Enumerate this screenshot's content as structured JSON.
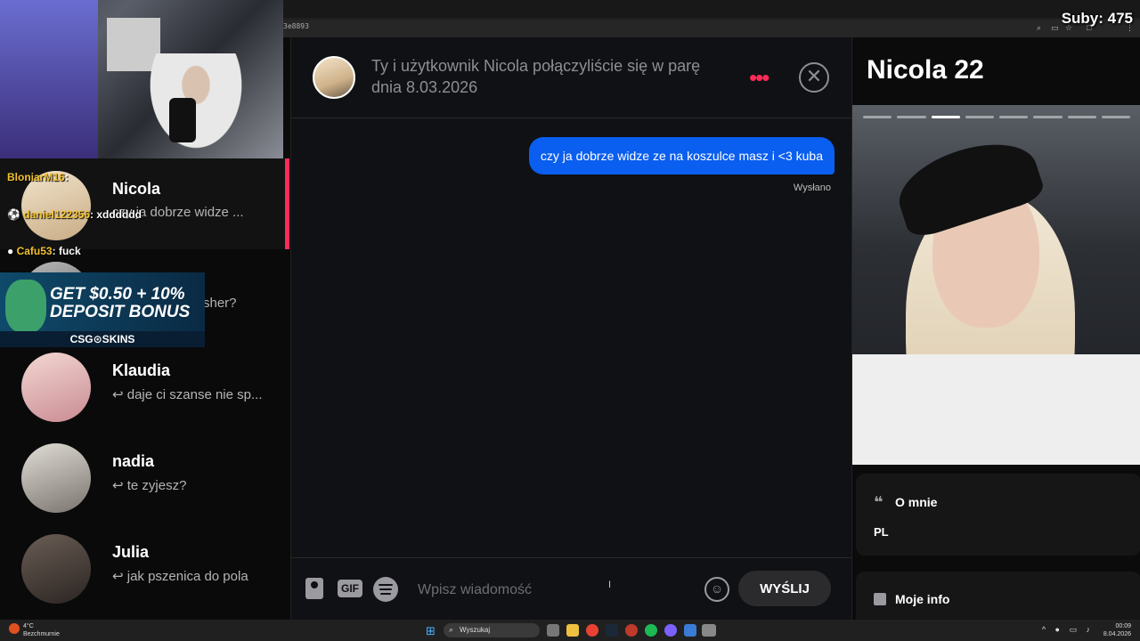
{
  "browser": {
    "url_fragment": "3e8893"
  },
  "stream": {
    "subs_label": "Suby: 475",
    "twitch_chat": [
      {
        "user": "BloniarM16",
        "message": ""
      },
      {
        "user": "daniel122356",
        "message": "xdddddd"
      },
      {
        "user": "Cafu53",
        "message": "fuck"
      }
    ],
    "ad": {
      "line1": "GET $0.50 + 10%",
      "line2": "DEPOSIT BONUS",
      "brand": "CSG⊙SKINS"
    }
  },
  "conversations": [
    {
      "name": "Nicola",
      "preview": "czy ja dobrze widze ...",
      "active": true
    },
    {
      "name": "",
      "preview": "sher?",
      "active": false
    },
    {
      "name": "Klaudia",
      "preview": "↩ daje ci szanse nie sp...",
      "active": false
    },
    {
      "name": "nadia",
      "preview": "↩ te zyjesz?",
      "active": false
    },
    {
      "name": "Julia",
      "preview": "↩ jak pszenica do pola",
      "active": false
    }
  ],
  "chat": {
    "match_text": "Ty i użytkownik Nicola połączyliście się w parę dnia 8.03.2026",
    "more_icon": "more-dots-icon",
    "close_icon": "close-circle-icon",
    "messages": [
      {
        "text": "czy ja dobrze widze ze na koszulce masz i <3 kuba",
        "status": "Wysłano",
        "outgoing": true
      }
    ],
    "composer": {
      "placeholder": "Wpisz wiadomość",
      "gif_label": "GIF",
      "send_label": "WYŚLIJ",
      "emoji_glyph": "☺"
    }
  },
  "profile": {
    "name_age": "Nicola 22",
    "photo_count": 8,
    "photo_active_index": 2,
    "about_title": "O mnie",
    "about_text": "PL",
    "info_title": "Moje info"
  },
  "taskbar": {
    "weather_temp": "4°C",
    "weather_desc": "Bezchmurnie",
    "search_placeholder": "Wyszukaj",
    "time": "00:09",
    "date": "8.04.2026"
  },
  "colors": {
    "accent": "#ff2a57",
    "bubble": "#0a5ef0",
    "panel_bg": "#101114"
  }
}
